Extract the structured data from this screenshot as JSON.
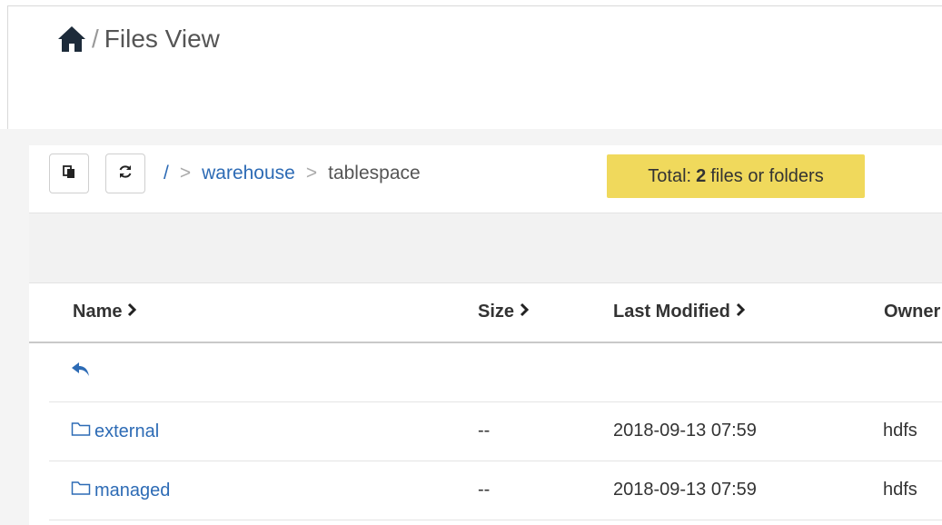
{
  "header": {
    "title": "Files View",
    "separator": "/"
  },
  "toolbar": {
    "copy_icon": "copy-icon",
    "refresh_icon": "refresh-icon"
  },
  "breadcrumb": {
    "root": "/",
    "sep1": ">",
    "folder": "warehouse",
    "sep2": ">",
    "current": "tablespace"
  },
  "summary": {
    "prefix": "Total:",
    "count": "2",
    "suffix": "files or folders"
  },
  "table": {
    "columns": [
      {
        "label": "Name"
      },
      {
        "label": "Size"
      },
      {
        "label": "Last Modified"
      },
      {
        "label": "Owner"
      }
    ],
    "back_icon": "reply-arrow-icon",
    "rows": [
      {
        "name": "external",
        "size": "--",
        "modified": "2018-09-13 07:59",
        "owner": "hdfs"
      },
      {
        "name": "managed",
        "size": "--",
        "modified": "2018-09-13 07:59",
        "owner": "hdfs"
      }
    ]
  },
  "colors": {
    "link": "#2d6bb5",
    "badge": "#f0d95c"
  }
}
